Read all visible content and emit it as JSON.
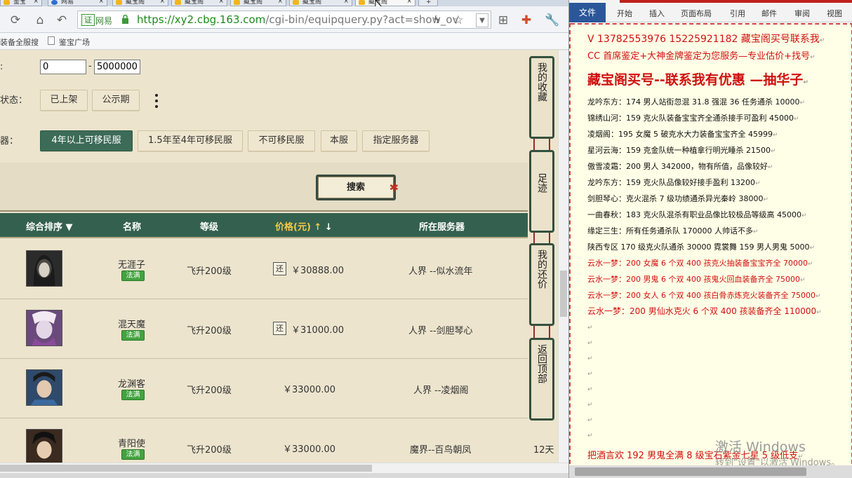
{
  "browser": {
    "tabs": [
      {
        "label": "鉴宝"
      },
      {
        "label": "网易"
      },
      {
        "label": "藏宝阁"
      },
      {
        "label": "藏宝阁"
      },
      {
        "label": "藏宝阁"
      },
      {
        "label": "藏宝阁"
      },
      {
        "label": "藏宝阁"
      }
    ],
    "new_tab": "+",
    "cert_badge": "证",
    "site_name": "网易",
    "url_host": "https://xy2.cbg.163.com",
    "url_path": "/cgi-bin/equipquery.py?act=show_ov",
    "bookmarks": [
      "装备全服搜",
      "鉴宝广场"
    ]
  },
  "filters": {
    "range_from": "0",
    "range_sep": "-",
    "range_to": "5000000",
    "status_label": "状态：",
    "status_options": [
      "已上架",
      "公示期"
    ],
    "server_label": "器：",
    "server_options": [
      "4年以上可移民服",
      "1.5年至4年可移民服",
      "不可移民服",
      "本服",
      "指定服务器"
    ],
    "search_label": "搜索"
  },
  "table": {
    "headers": {
      "sort": "综合排序",
      "name": "名称",
      "level": "等级",
      "price": "价格(元)",
      "server": "所在服务器"
    },
    "rows": [
      {
        "name": "无涯子",
        "badge": "法满",
        "level": "飞升200级",
        "has_huan": true,
        "huan": "还",
        "price": "￥30888.00",
        "server": "人界 --似水流年",
        "extra": ""
      },
      {
        "name": "混天魔",
        "badge": "法满",
        "level": "飞升200级",
        "has_huan": true,
        "huan": "还",
        "price": "￥31000.00",
        "server": "人界 --剑胆琴心",
        "extra": ""
      },
      {
        "name": "龙渊客",
        "badge": "法满",
        "level": "飞升200级",
        "has_huan": false,
        "huan": "",
        "price": "￥33000.00",
        "server": "人界 --凌烟阁",
        "extra": ""
      },
      {
        "name": "青阳使",
        "badge": "法满",
        "level": "飞升200级",
        "has_huan": false,
        "huan": "",
        "price": "￥33000.00",
        "server": "魔界--百鸟朝凤",
        "extra": "12天"
      }
    ]
  },
  "side_panel": {
    "favorites": "我的收藏",
    "footprint": "足迹",
    "my_bargain": "我的还价",
    "back_top": "返回顶部"
  },
  "word": {
    "ribbon_tabs": [
      "文件",
      "开始",
      "插入",
      "页面布局",
      "引用",
      "邮件",
      "审阅",
      "视图"
    ],
    "lines": [
      {
        "text": "V 13782553976    15225921182  藏宝阁买号联系我",
        "color": "red",
        "size": 14
      },
      {
        "text": "CC 首席鉴定+大神金牌鉴定为您服务—专业估价+找号",
        "color": "red",
        "size": 13
      },
      {
        "text": "藏宝阁买号--联系我有优惠 —抽华子",
        "color": "red",
        "size": 19
      },
      {
        "text": "龙吟东方：174 男人站街忽混 31.8 强混 36 任务通杀 10000",
        "color": "black",
        "size": 11
      },
      {
        "text": "锦绣山河：159 克火队装备宝宝齐全通杀接手可盈利 45000",
        "color": "black",
        "size": 11
      },
      {
        "text": "凌烟阁：195 女魔 5 破克水大力装备宝宝齐全 45999",
        "color": "black",
        "size": 11
      },
      {
        "text": "星河云海：159 克金队统一种植拿行明光睡杀 21500",
        "color": "black",
        "size": 11
      },
      {
        "text": "傲雪凌霜：200 男人 342000，物有所值，品像较好",
        "color": "black",
        "size": 11
      },
      {
        "text": "龙吟东方：159 克火队品像较好接手盈利 13200",
        "color": "black",
        "size": 11
      },
      {
        "text": "剑胆琴心：克火混杀 7 级功绩通杀异光秦岭 38000",
        "color": "black",
        "size": 11
      },
      {
        "text": "一曲春秋：183 克火队混杀有职业品像比较极品等级高 45000",
        "color": "black",
        "size": 11
      },
      {
        "text": "缘定三生：所有任务通杀队 170000 人帅话不多",
        "color": "black",
        "size": 11
      },
      {
        "text": "陕西专区 170 级克火队通杀 30000      霓裳舞 159 男人男鬼 5000",
        "color": "black",
        "size": 11
      },
      {
        "text": "云水一梦：200 女魔 6 个双 400 孩克火抽装备宝宝齐全 70000",
        "color": "red",
        "size": 11
      },
      {
        "text": "云水一梦：200 男鬼 6 个双 400 孩鬼火回血装备齐全 75000",
        "color": "red",
        "size": 11
      },
      {
        "text": "云水一梦：200 女人 6 个双 400 孩白骨赤炼克火装备齐全 75000",
        "color": "red",
        "size": 11
      },
      {
        "text": "云水一梦：200 男仙水克火 6 个双 400 孩装备齐全 110000",
        "color": "red",
        "size": 12
      },
      {
        "text": "把酒言欢 192 男鬼全满 8 级宝石紫金七星 5 级低支",
        "color": "red",
        "size": 13
      }
    ],
    "watermark_title": "激活 Windows",
    "watermark_sub": "转到\"设置\"以激活 Windows。"
  }
}
